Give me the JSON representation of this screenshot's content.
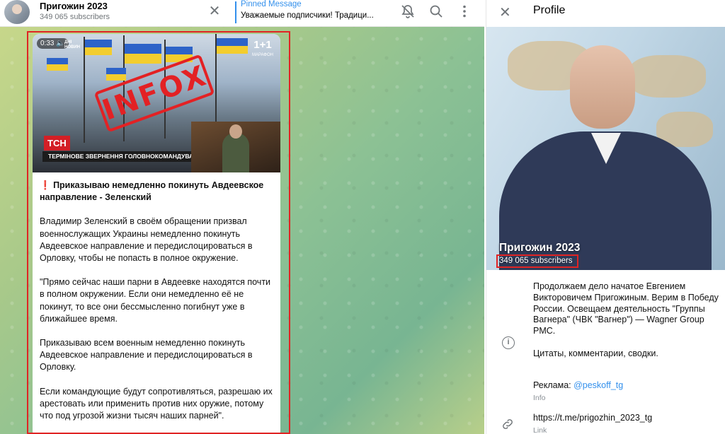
{
  "chat": {
    "channel_name": "Пригожин 2023",
    "subscribers": "349 065 subscribers",
    "pinned_title": "Pinned Message",
    "pinned_text": "Уважаемые подписчики! Традици..."
  },
  "video": {
    "duration": "0:33",
    "corner_logo_line1": "ДНІ",
    "corner_logo_line2": "НОВИН",
    "channel_logo": "1+1",
    "channel_logo_sub": "МАРАФОН",
    "stamp": "INFOX",
    "tsn_logo": "ТСН",
    "lower_third": "ТЕРМІНОВЕ ЗВЕРНЕННЯ ГОЛОВНОКОМАНДУВАЧА"
  },
  "message": {
    "headline": "Приказываю немедленно покинуть Авдеевское направление - Зеленский",
    "headline_mark": "❗",
    "paragraphs": [
      "Владимир Зеленский в своём обращении призвал военнослужащих Украины немедленно покинуть Авдеевское направление и передислоцироваться в Орловку, чтобы не попасть в полное окружение.",
      "\"Прямо сейчас наши парни в Авдеевке находятся почти в полном окружении. Если они немедленно её не покинут, то все они бессмысленно погибнут уже в ближайшее время.",
      "Приказываю всем военным немедленно покинуть Авдеевское направление и передислоцироваться в Орловку.",
      "Если командующие будут сопротивляться, разрешаю их арестовать или применить против них оружие, потому что под угрозой жизни тысяч наших парней\"."
    ]
  },
  "profile": {
    "title": "Profile",
    "name": "Пригожин 2023",
    "subscribers": "349 065 subscribers",
    "description_1": "Продолжаем дело начатое Евгением Викторовичем Пригожиным. Верим в Победу России. Освещаем деятельность \"Группы Вагнера\" (ЧВК \"Вагнер\") — Wagner Group PMC.",
    "description_2": "Цитаты, комментарии, сводки.",
    "ad_label": "Реклама: ",
    "ad_handle": "@peskoff_tg",
    "info_label": "Info",
    "link_url": "https://t.me/prigozhin_2023_tg",
    "link_label": "Link"
  },
  "icons": {
    "close": "close-icon",
    "mute": "bell-off-icon",
    "search": "search-icon",
    "more": "more-vertical-icon",
    "info": "info-icon",
    "link": "link-icon",
    "volume": "volume-icon"
  },
  "colors": {
    "accent": "#3390ec",
    "highlight_frame": "#e02424",
    "stamp": "#e32124"
  }
}
